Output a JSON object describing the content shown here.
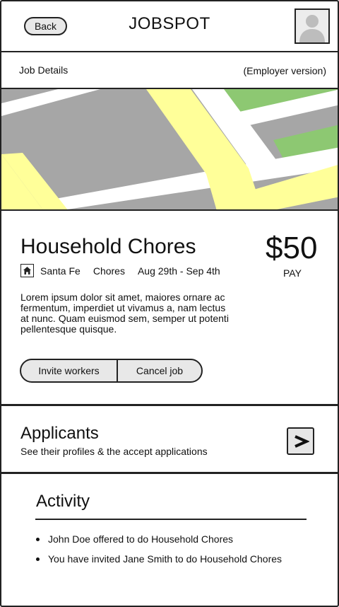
{
  "header": {
    "back_label": "Back",
    "app_title": "JOBSPOT",
    "avatar_icon": "user-avatar-icon"
  },
  "subheader": {
    "left": "Job Details",
    "right": "(Employer version)"
  },
  "map": {
    "colors": {
      "block": "#a6a6a6",
      "road": "#ffffff",
      "major_road": "#ffff99",
      "park": "#8dc872"
    }
  },
  "job": {
    "title": "Household Chores",
    "location_icon": "home-icon",
    "location": "Santa Fe",
    "category": "Chores",
    "dates": "Aug 29th - Sep 4th",
    "price": "$50",
    "price_caption": "PAY",
    "description": "Lorem ipsum dolor sit amet, maiores ornare ac fermentum, imperdiet ut vivamus a, nam lectus at nunc. Quam euismod sem, semper ut potenti pellentesque quisque.",
    "actions": {
      "invite_label": "Invite workers",
      "cancel_label": "Cancel job"
    }
  },
  "applicants": {
    "title": "Applicants",
    "subtitle": "See their profiles & the accept applications",
    "arrow_icon": "chevron-right-icon"
  },
  "activity": {
    "title": "Activity",
    "items": [
      "John Doe offered to do Household Chores",
      "You have invited  Jane Smith to do Household Chores"
    ]
  }
}
